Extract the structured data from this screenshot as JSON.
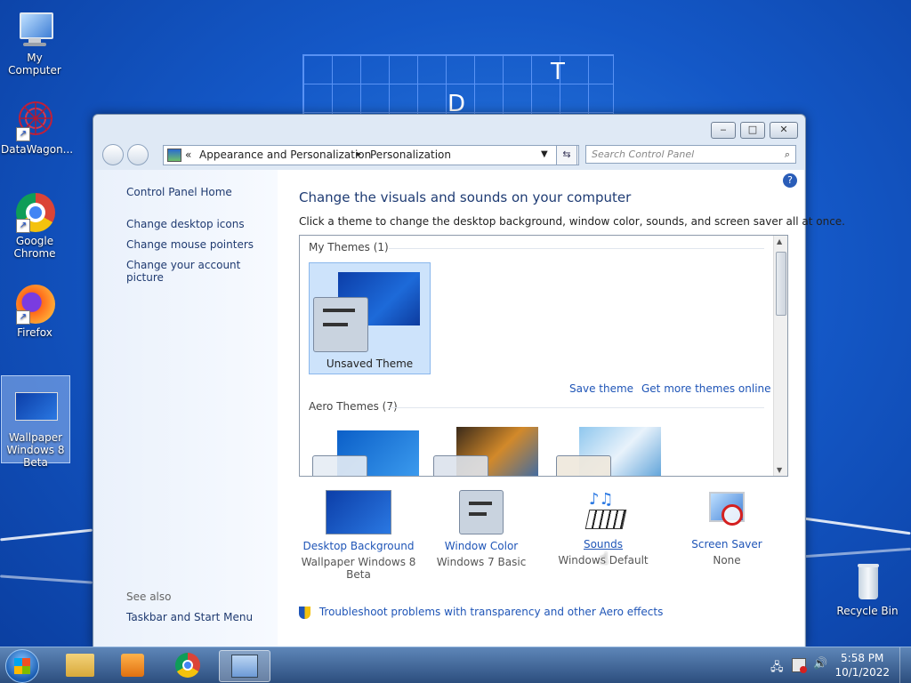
{
  "wallpaper": {
    "grid_letters": [
      "T",
      "D"
    ]
  },
  "desktop_icons": [
    {
      "label": "My Computer"
    },
    {
      "label": "DataWagon..."
    },
    {
      "label": "Google Chrome"
    },
    {
      "label": "Firefox"
    },
    {
      "label": "Wallpaper Windows 8 Beta"
    },
    {
      "label": "Recycle Bin"
    }
  ],
  "window": {
    "buttons": {
      "minimize": "‒",
      "maximize": "□",
      "close": "✕"
    },
    "address": {
      "chevron": "«",
      "crumb1": "Appearance and Personalization",
      "separator": "▸",
      "crumb2": "Personalization"
    },
    "search_placeholder": "Search Control Panel",
    "help": "?"
  },
  "left_pane": {
    "home": "Control Panel Home",
    "links": [
      "Change desktop icons",
      "Change mouse pointers",
      "Change your account picture"
    ],
    "see_also_label": "See also",
    "see_also_links": [
      "Taskbar and Start Menu"
    ]
  },
  "main": {
    "heading": "Change the visuals and sounds on your computer",
    "subheading": "Click a theme to change the desktop background, window color, sounds, and screen saver all at once.",
    "my_themes_label": "My Themes (1)",
    "unsaved_theme": "Unsaved Theme",
    "save_theme": "Save theme",
    "get_more": "Get more themes online",
    "aero_themes_label": "Aero Themes (7)",
    "bottom_items": [
      {
        "caption": "Desktop Background",
        "value": "Wallpaper Windows 8 Beta"
      },
      {
        "caption": "Window Color",
        "value": "Windows 7 Basic"
      },
      {
        "caption": "Sounds",
        "value": "Windows Default"
      },
      {
        "caption": "Screen Saver",
        "value": "None"
      }
    ],
    "troubleshoot": "Troubleshoot problems with transparency and other Aero effects"
  },
  "taskbar": {
    "clock_time": "5:58 PM",
    "clock_date": "10/1/2022"
  },
  "colors": {
    "accent": "#1f55b7",
    "taskbar": "#2c4e7e",
    "desktop": "#1458c7"
  }
}
